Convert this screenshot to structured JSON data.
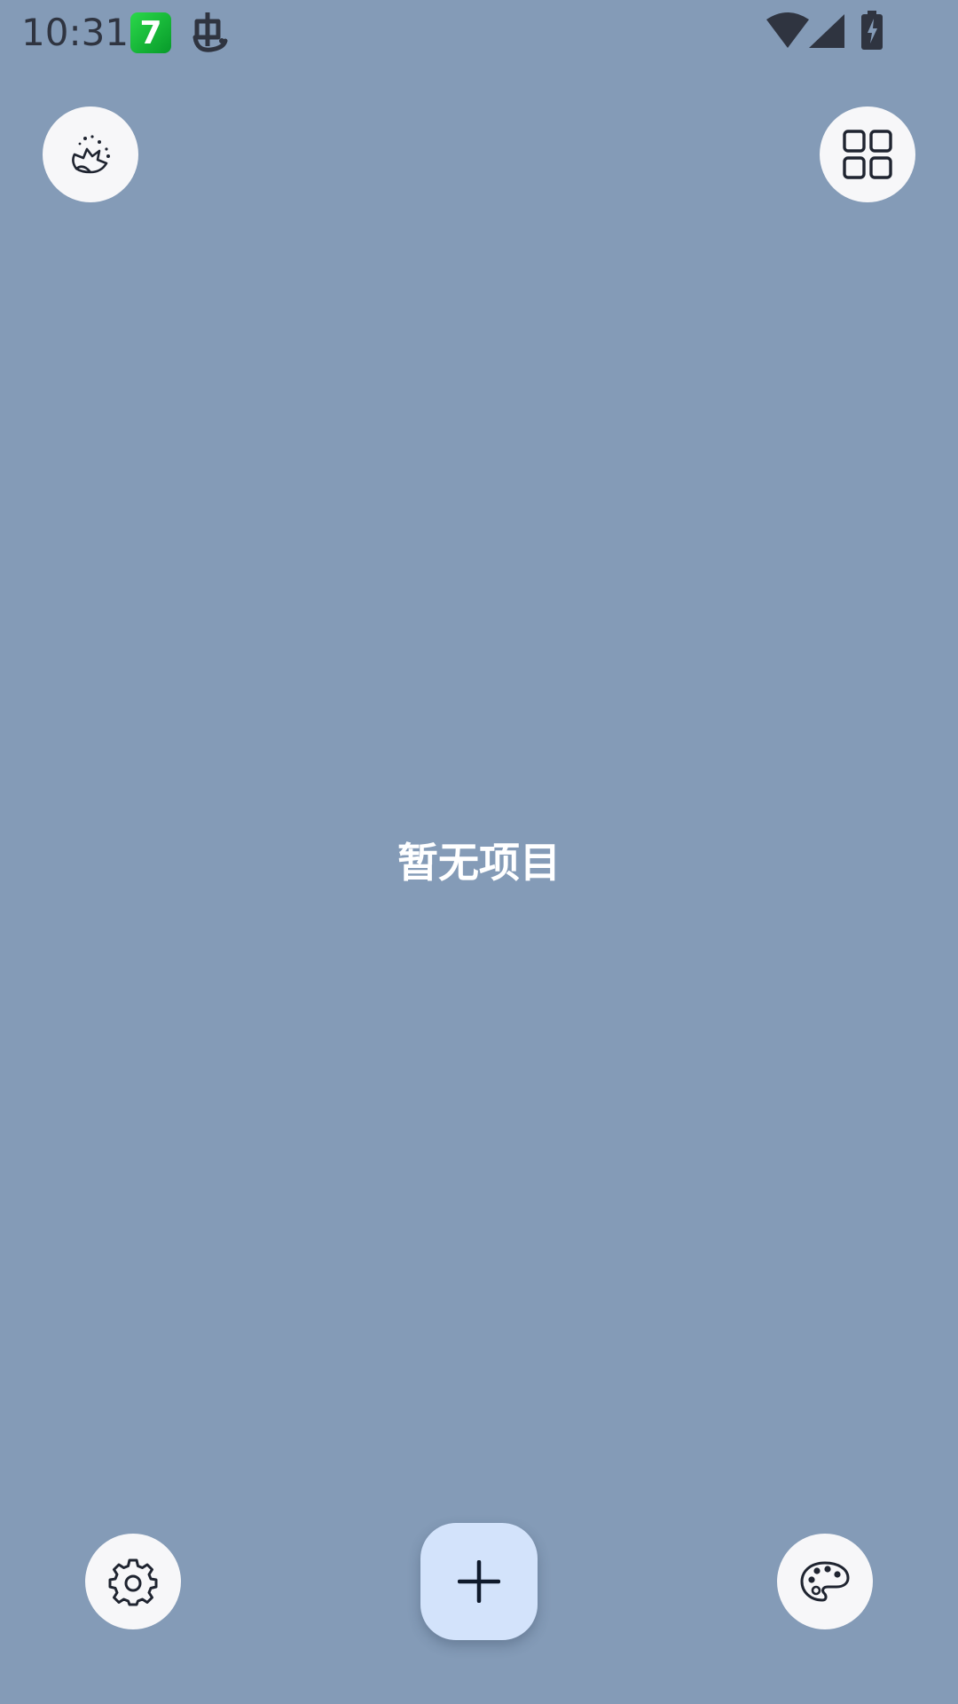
{
  "status_bar": {
    "time": "10:31",
    "app_badge_text": "7",
    "icons": [
      "seven-app-icon",
      "bug-app-icon",
      "wifi-icon",
      "cell-signal-icon",
      "battery-charging-icon"
    ]
  },
  "top_bar": {
    "left_button_icon": "cleaning-sparkle-icon",
    "right_button_icon": "grid-view-icon"
  },
  "main": {
    "empty_message": "暂无项目"
  },
  "bottom_bar": {
    "left_button_icon": "gear-icon",
    "center_button_icon": "plus-icon",
    "right_button_icon": "palette-icon"
  },
  "colors": {
    "background": "#849bb7",
    "button_bg": "#f7f7f9",
    "fab_bg": "#d3e3fb",
    "icon_color": "#1f2430",
    "text_color": "#ffffff"
  }
}
